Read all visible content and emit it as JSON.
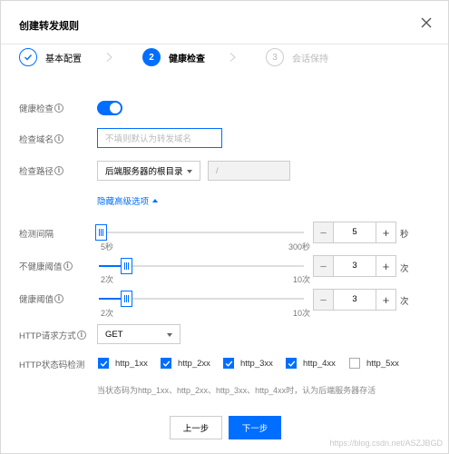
{
  "dialog": {
    "title": "创建转发规则"
  },
  "steps": [
    {
      "number": "",
      "label": "基本配置",
      "state": "done"
    },
    {
      "number": "2",
      "label": "健康检查",
      "state": "active"
    },
    {
      "number": "3",
      "label": "会话保持",
      "state": "todo"
    }
  ],
  "health_check": {
    "label": "健康检查",
    "enabled": true
  },
  "check_domain": {
    "label": "检查域名",
    "placeholder": "不填则默认为转发域名"
  },
  "check_path": {
    "label": "检查路径",
    "select_value": "后端服务器的根目录",
    "path_value": "/"
  },
  "advanced_toggle": "隐藏高级选项",
  "interval": {
    "label": "检测间隔",
    "min_label": "5秒",
    "max_label": "300秒",
    "value": "5",
    "unit": "秒"
  },
  "unhealthy_threshold": {
    "label": "不健康阈值",
    "min_label": "2次",
    "max_label": "10次",
    "value": "3",
    "unit": "次"
  },
  "healthy_threshold": {
    "label": "健康阈值",
    "min_label": "2次",
    "max_label": "10次",
    "value": "3",
    "unit": "次"
  },
  "http_method": {
    "label": "HTTP请求方式",
    "value": "GET"
  },
  "http_status": {
    "label": "HTTP状态码检测",
    "options": [
      {
        "label": "http_1xx",
        "checked": true
      },
      {
        "label": "http_2xx",
        "checked": true
      },
      {
        "label": "http_3xx",
        "checked": true
      },
      {
        "label": "http_4xx",
        "checked": true
      },
      {
        "label": "http_5xx",
        "checked": false
      }
    ],
    "hint": "当状态码为http_1xx、http_2xx、http_3xx、http_4xx时，认为后端服务器存活"
  },
  "footer": {
    "prev_label": "上一步",
    "next_label": "下一步"
  },
  "watermark": "https://blog.csdn.net/ASZJBGD",
  "colors": {
    "accent": "#006eff"
  }
}
